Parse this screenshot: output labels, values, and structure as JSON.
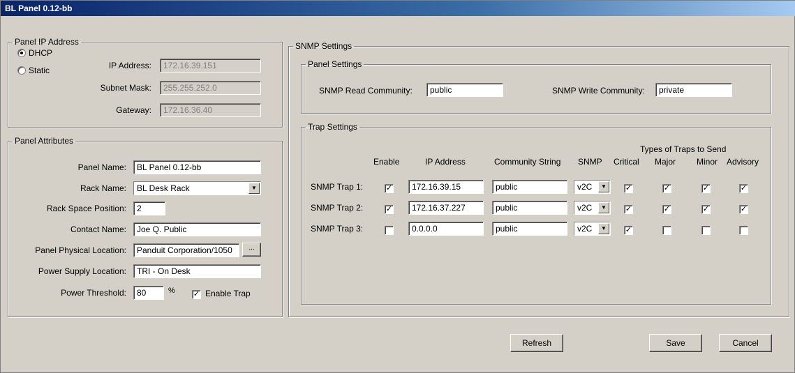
{
  "window": {
    "title": "BL Panel 0.12-bb"
  },
  "ip_group": {
    "legend": "Panel IP Address",
    "dhcp_label": "DHCP",
    "static_label": "Static",
    "mode": "DHCP",
    "ip_label": "IP Address:",
    "ip_value": "172.16.39.151",
    "subnet_label": "Subnet Mask:",
    "subnet_value": "255.255.252.0",
    "gateway_label": "Gateway:",
    "gateway_value": "172.16.36.40"
  },
  "attributes": {
    "legend": "Panel Attributes",
    "panel_name_label": "Panel Name:",
    "panel_name_value": "BL Panel 0.12-bb",
    "rack_name_label": "Rack Name:",
    "rack_name_value": "BL Desk Rack",
    "rack_pos_label": "Rack Space Position:",
    "rack_pos_value": "2",
    "contact_label": "Contact Name:",
    "contact_value": "Joe Q. Public",
    "location_label": "Panel Physical Location:",
    "location_value": "Panduit Corporation/1050",
    "browse_label": "...",
    "psu_label": "Power Supply Location:",
    "psu_value": "TRI - On Desk",
    "threshold_label": "Power Threshold:",
    "threshold_value": "80",
    "threshold_unit": "%",
    "enable_trap_label": "Enable Trap",
    "enable_trap_checked": true
  },
  "snmp": {
    "legend": "SNMP Settings",
    "panel_settings_legend": "Panel Settings",
    "read_label": "SNMP Read Community:",
    "read_value": "public",
    "write_label": "SNMP Write Community:",
    "write_value": "private",
    "trap_settings_legend": "Trap Settings",
    "types_heading": "Types of Traps to Send",
    "headers": {
      "enable": "Enable",
      "ip": "IP Address",
      "community": "Community String",
      "snmp": "SNMP",
      "critical": "Critical",
      "major": "Major",
      "minor": "Minor",
      "advisory": "Advisory"
    },
    "traps": [
      {
        "label": "SNMP Trap 1:",
        "enable": true,
        "ip": "172.16.39.15",
        "community": "public",
        "version": "v2C",
        "critical": true,
        "major": true,
        "minor": true,
        "advisory": true
      },
      {
        "label": "SNMP Trap 2:",
        "enable": true,
        "ip": "172.16.37.227",
        "community": "public",
        "version": "v2C",
        "critical": true,
        "major": true,
        "minor": true,
        "advisory": true
      },
      {
        "label": "SNMP Trap 3:",
        "enable": false,
        "ip": "0.0.0.0",
        "community": "public",
        "version": "v2C",
        "critical": true,
        "major": false,
        "minor": false,
        "advisory": false
      }
    ]
  },
  "buttons": {
    "refresh": "Refresh",
    "save": "Save",
    "cancel": "Cancel"
  }
}
